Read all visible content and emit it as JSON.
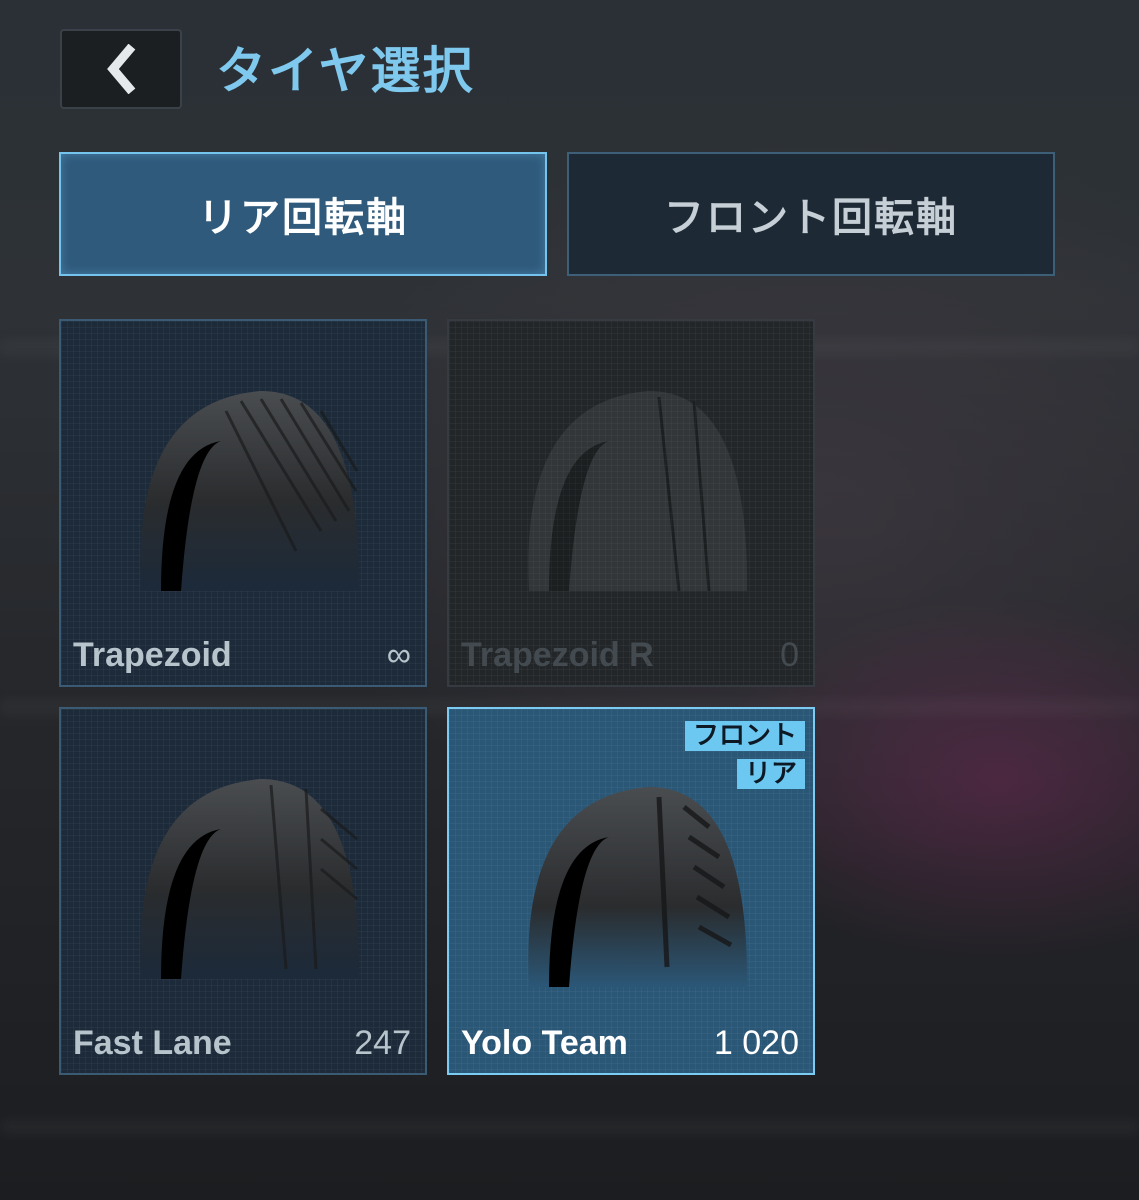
{
  "header": {
    "back_icon": "chevron-left-icon",
    "title": "タイヤ選択"
  },
  "tabs": [
    {
      "label": "リア回転軸",
      "active": true
    },
    {
      "label": "フロント回転軸",
      "active": false
    }
  ],
  "tires": [
    {
      "name": "Trapezoid",
      "count": "∞",
      "state": "normal"
    },
    {
      "name": "Trapezoid R",
      "count": "0",
      "state": "locked"
    },
    {
      "name": "Fast Lane",
      "count": "247",
      "state": "normal"
    },
    {
      "name": "Yolo Team",
      "count": "1 020",
      "state": "selected",
      "badges": [
        "フロント",
        "リア"
      ]
    }
  ],
  "colors": {
    "accent": "#7fc8ee",
    "active_tab": "#2f5a7c",
    "badge": "#6cc8f0"
  }
}
